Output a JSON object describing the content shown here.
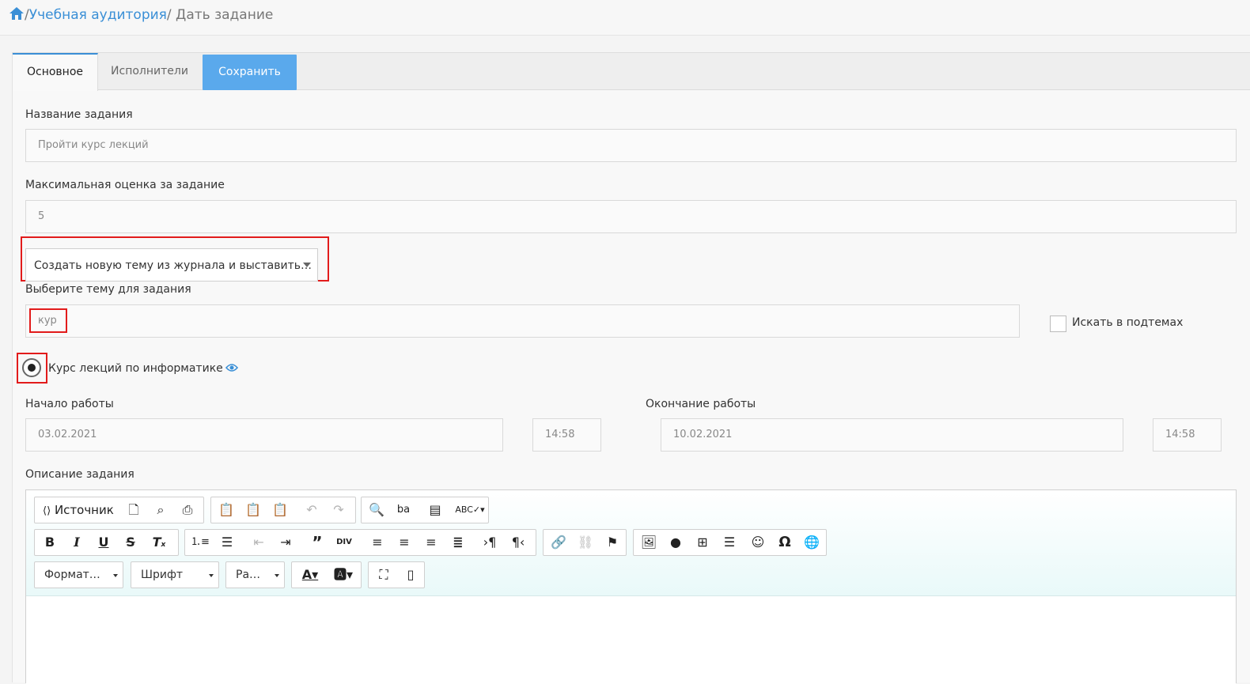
{
  "breadcrumb": {
    "home_icon": "home-icon",
    "sep1": "/",
    "link": "Учебная аудитория",
    "sep2": "/",
    "current": "Дать задание"
  },
  "tabs": {
    "main": "Основное",
    "executors": "Исполнители",
    "save": "Сохранить"
  },
  "form": {
    "task_name_label": "Название задания",
    "task_name_value": "Пройти курс лекций",
    "max_grade_label": "Максимальная оценка за задание",
    "max_grade_value": "5",
    "mode_select": "Создать новую тему из журнала и выставить…",
    "topic_label": "Выберите тему для задания",
    "topic_search_value": "кур",
    "search_subtopics_label": "Искать в подтемах",
    "topic_option": "Курс лекций по информатике",
    "start_label": "Начало работы",
    "start_date": "03.02.2021",
    "start_time": "14:58",
    "end_label": "Окончание работы",
    "end_date": "10.02.2021",
    "end_time": "14:58",
    "description_label": "Описание задания"
  },
  "editor": {
    "source_label": "Источник",
    "format_combo": "Формат…",
    "font_combo": "Шрифт",
    "size_combo": "Ра…",
    "colors": {
      "accent": "#3a8fd6",
      "save": "#5aa9ec",
      "highlight": "#e21b1b"
    }
  }
}
